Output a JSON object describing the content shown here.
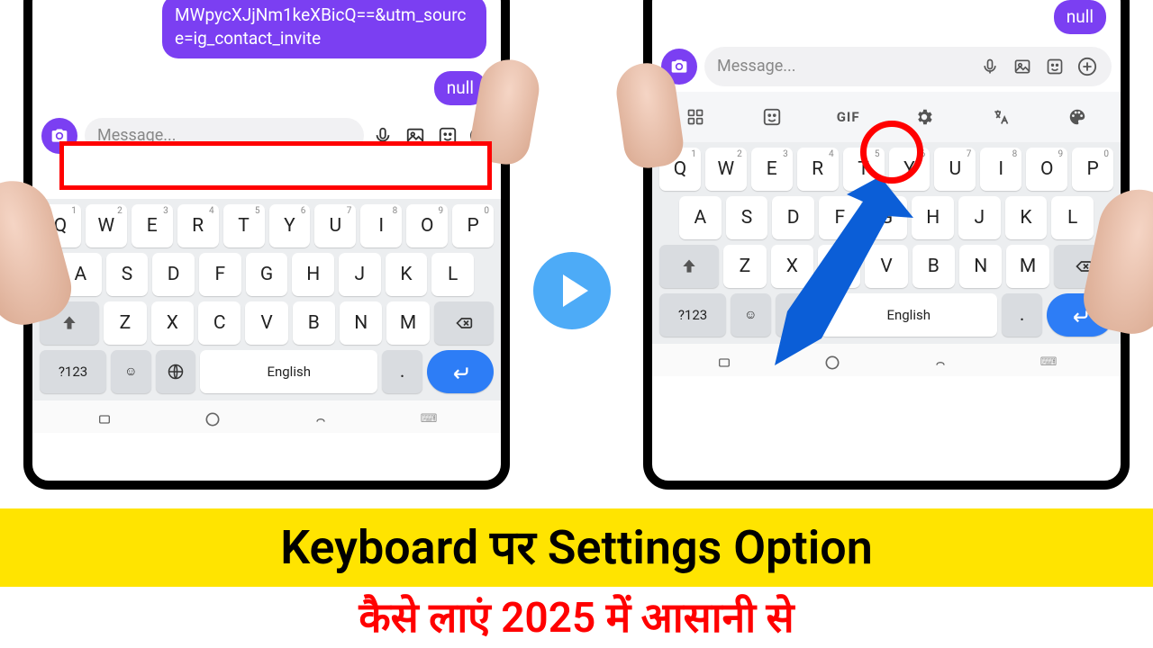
{
  "chat": {
    "bubble_text": "MWpycXJjNm1keXBicQ==&utm_source=ig_contact_invite",
    "null_badge": "null"
  },
  "message_bar": {
    "placeholder": "Message..."
  },
  "toolbar": {
    "gif_label": "GIF"
  },
  "keyboard": {
    "row1": [
      {
        "k": "Q",
        "s": "1"
      },
      {
        "k": "W",
        "s": "2"
      },
      {
        "k": "E",
        "s": "3"
      },
      {
        "k": "R",
        "s": "4"
      },
      {
        "k": "T",
        "s": "5"
      },
      {
        "k": "Y",
        "s": "6"
      },
      {
        "k": "U",
        "s": "7"
      },
      {
        "k": "I",
        "s": "8"
      },
      {
        "k": "O",
        "s": "9"
      },
      {
        "k": "P",
        "s": "0"
      }
    ],
    "row2": [
      "A",
      "S",
      "D",
      "F",
      "G",
      "H",
      "J",
      "K",
      "L"
    ],
    "row3": [
      "Z",
      "X",
      "C",
      "V",
      "B",
      "N",
      "M"
    ],
    "numkey": "?123",
    "comma": ",",
    "space_label": "English",
    "period": "."
  },
  "headline": "Keyboard पर Settings Option",
  "subtitle": "कैसे लाएं 2025 में आसानी से"
}
